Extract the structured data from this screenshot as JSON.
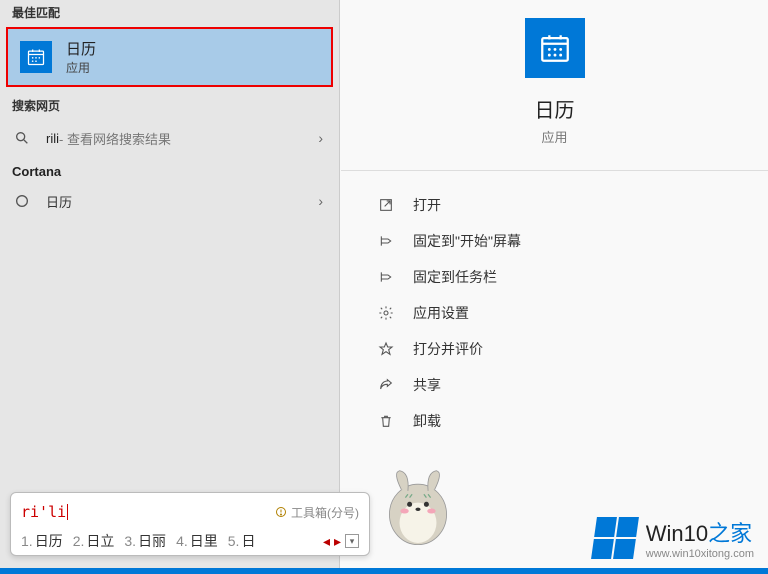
{
  "left": {
    "best_header": "最佳匹配",
    "best": {
      "title": "日历",
      "sub": "应用"
    },
    "web_header": "搜索网页",
    "web": {
      "query": "rili",
      "hint": " - 查看网络搜索结果"
    },
    "cortana_header": "Cortana",
    "cortana_item": "日历"
  },
  "hero": {
    "title": "日历",
    "sub": "应用"
  },
  "actions": [
    {
      "icon": "open",
      "label": "打开"
    },
    {
      "icon": "pin-start",
      "label": "固定到\"开始\"屏幕"
    },
    {
      "icon": "pin-taskbar",
      "label": "固定到任务栏"
    },
    {
      "icon": "settings",
      "label": "应用设置"
    },
    {
      "icon": "rate",
      "label": "打分并评价"
    },
    {
      "icon": "share",
      "label": "共享"
    },
    {
      "icon": "uninstall",
      "label": "卸载"
    }
  ],
  "ime": {
    "input": "ri'li",
    "toolbox": "工具箱(分号)",
    "candidates": [
      {
        "n": "1.",
        "w": "日历"
      },
      {
        "n": "2.",
        "w": "日立"
      },
      {
        "n": "3.",
        "w": "日丽"
      },
      {
        "n": "4.",
        "w": "日里"
      },
      {
        "n": "5.",
        "w": "日"
      }
    ]
  },
  "watermark": {
    "brand_a": "Win10",
    "brand_b": "之家",
    "url": "www.win10xitong.com"
  }
}
